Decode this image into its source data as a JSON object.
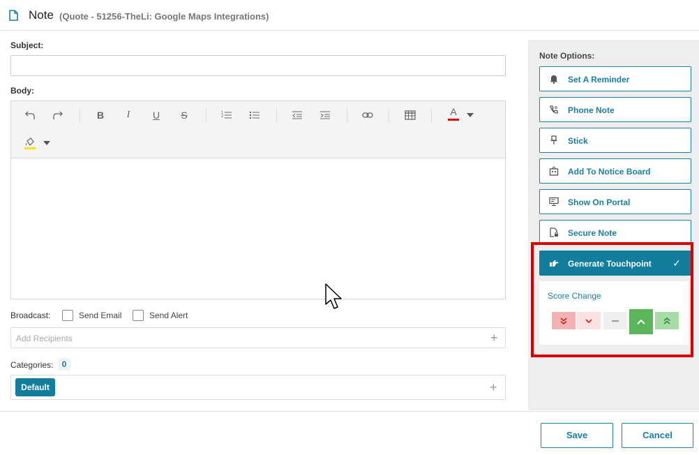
{
  "header": {
    "title": "Note",
    "subtitle": "(Quote - 51256-TheLi: Google Maps Integrations)"
  },
  "form": {
    "subject_label": "Subject:",
    "subject_value": "",
    "body_label": "Body:",
    "broadcast_label": "Broadcast:",
    "send_email_label": "Send Email",
    "send_alert_label": "Send Alert",
    "recipients_placeholder": "Add Recipients",
    "categories_label": "Categories:",
    "categories_count": "0",
    "category_tag": "Default"
  },
  "toolbar": {
    "icons": [
      "undo-icon",
      "redo-icon",
      "bold-icon",
      "italic-icon",
      "underline-icon",
      "strikethrough-icon",
      "ordered-list-icon",
      "unordered-list-icon",
      "outdent-icon",
      "indent-icon",
      "link-icon",
      "table-icon",
      "font-color-icon",
      "background-color-icon"
    ],
    "font_color_swatch": "#e00000",
    "background_color_swatch": "#f5e600",
    "bold_glyph": "B",
    "italic_glyph": "I",
    "underline_glyph": "U",
    "strike_glyph": "S",
    "font_color_glyph": "A"
  },
  "note_options": {
    "title": "Note Options:",
    "items": [
      {
        "label": "Set A Reminder",
        "icon": "bell-icon"
      },
      {
        "label": "Phone Note",
        "icon": "phone-icon"
      },
      {
        "label": "Stick",
        "icon": "pin-icon"
      },
      {
        "label": "Add To Notice Board",
        "icon": "notice-board-icon"
      },
      {
        "label": "Show On Portal",
        "icon": "monitor-icon"
      },
      {
        "label": "Secure Note",
        "icon": "lock-document-icon"
      },
      {
        "label": "Generate Touchpoint",
        "icon": "pointing-hand-icon",
        "active": true
      }
    ],
    "score_change": {
      "title": "Score Change",
      "options": [
        "double-down",
        "down",
        "neutral",
        "up",
        "double-up"
      ],
      "selected": "up"
    }
  },
  "footer": {
    "save_label": "Save",
    "cancel_label": "Cancel"
  },
  "colors": {
    "accent": "#127e9c",
    "highlight_border": "#d90000",
    "score_negative_strong": "#f4b3b3",
    "score_negative": "#fbe1e1",
    "score_positive_strong": "#5bb55b",
    "score_positive": "#a9dba9"
  }
}
